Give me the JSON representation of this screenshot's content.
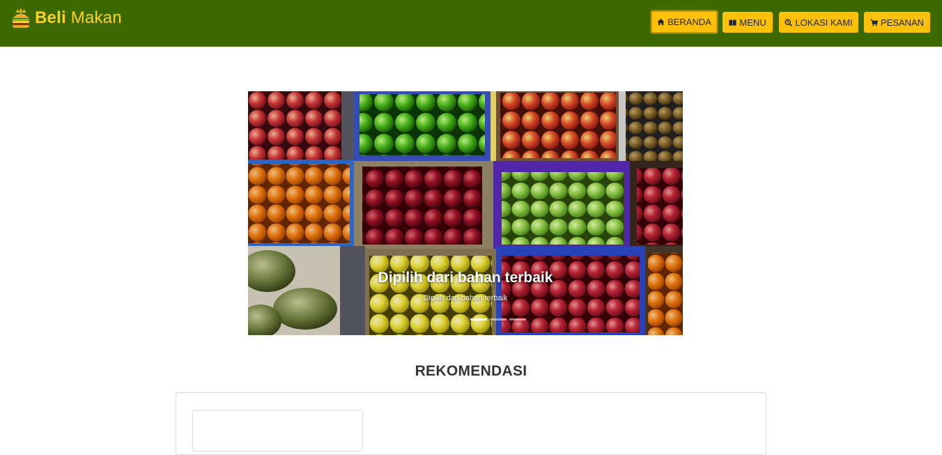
{
  "header": {
    "brand_bold": "Beli",
    "brand_rest": "Makan",
    "logo_icon": "burger-icon",
    "colors": {
      "bar": "#3c6a00",
      "brand": "#ffd21a",
      "button": "#ffc107"
    }
  },
  "nav": {
    "items": [
      {
        "label": "BERANDA",
        "icon": "home-icon",
        "active": true
      },
      {
        "label": "MENU",
        "icon": "book-icon",
        "active": false
      },
      {
        "label": "LOKASI KAMI",
        "icon": "search-location-icon",
        "active": false
      },
      {
        "label": "PESANAN",
        "icon": "cart-icon",
        "active": false
      }
    ]
  },
  "carousel": {
    "caption_title": "Dipilih dari bahan terbaik",
    "caption_text": "Dipilih dari bahan terbaik",
    "slide_count": 3,
    "active_slide": 1
  },
  "recommendations": {
    "title": "REKOMENDASI"
  }
}
